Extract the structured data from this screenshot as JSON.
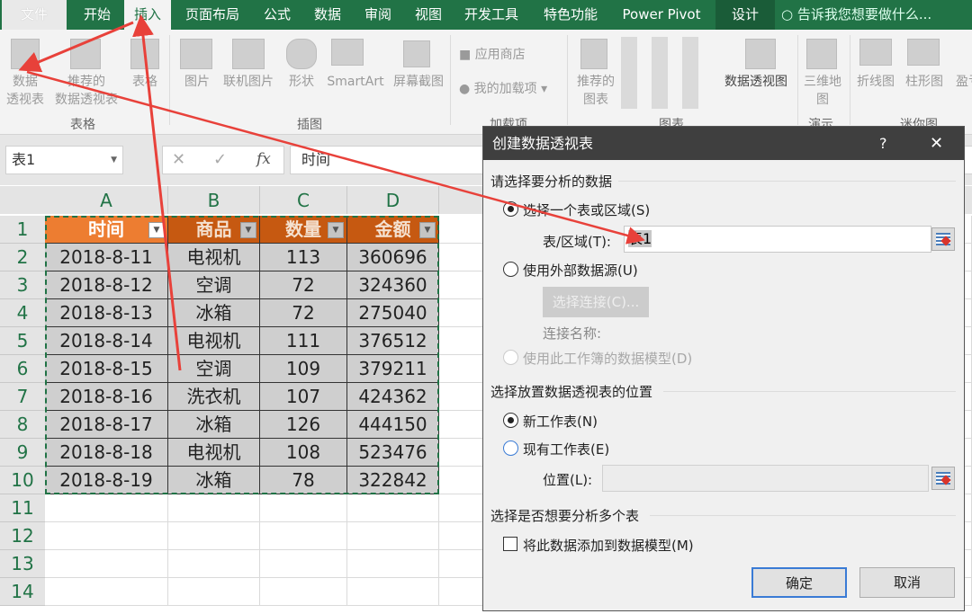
{
  "tabs": [
    "文件",
    "开始",
    "插入",
    "页面布局",
    "公式",
    "数据",
    "审阅",
    "视图",
    "开发工具",
    "特色功能",
    "Power Pivot",
    "设计"
  ],
  "tell_me": "告诉我您想要做什么...",
  "ribbon": {
    "pivot_table": [
      "数据",
      "透视表"
    ],
    "recommended_pivot": [
      "推荐的",
      "数据透视表"
    ],
    "table": "表格",
    "pictures": "图片",
    "online_pictures": "联机图片",
    "shapes": "形状",
    "smartart": "SmartArt",
    "screenshot": "屏幕截图",
    "store": "应用商店",
    "my_addins": "我的加载项",
    "recommended_charts": [
      "推荐的",
      "图表"
    ],
    "pivot_chart": "数据透视图",
    "map3d": [
      "三维地",
      "图"
    ],
    "line": "折线图",
    "column": "柱形图",
    "winloss": "盈亏",
    "groups": {
      "tables": "表格",
      "illustrations": "插图",
      "addins": "加载项",
      "charts": "图表",
      "tours": "演示",
      "sparklines": "迷你图"
    }
  },
  "formula_bar": {
    "name_box": "表1",
    "fx": "fx",
    "cancel": "✕",
    "enter": "✓",
    "content": "时间"
  },
  "sheet": {
    "columns": [
      "A",
      "B",
      "C",
      "D"
    ],
    "rows": [
      "1",
      "2",
      "3",
      "4",
      "5",
      "6",
      "7",
      "8",
      "9",
      "10",
      "11",
      "12",
      "13",
      "14"
    ],
    "headers": [
      "时间",
      "商品",
      "数量",
      "金额"
    ],
    "data": [
      [
        "2018-8-11",
        "电视机",
        "113",
        "360696"
      ],
      [
        "2018-8-12",
        "空调",
        "72",
        "324360"
      ],
      [
        "2018-8-13",
        "冰箱",
        "72",
        "275040"
      ],
      [
        "2018-8-14",
        "电视机",
        "111",
        "376512"
      ],
      [
        "2018-8-15",
        "空调",
        "109",
        "379211"
      ],
      [
        "2018-8-16",
        "洗衣机",
        "107",
        "424362"
      ],
      [
        "2018-8-17",
        "冰箱",
        "126",
        "444150"
      ],
      [
        "2018-8-18",
        "电视机",
        "108",
        "523476"
      ],
      [
        "2018-8-19",
        "冰箱",
        "78",
        "322842"
      ]
    ]
  },
  "dialog": {
    "title": "创建数据透视表",
    "help": "?",
    "close": "✕",
    "section1": "请选择要分析的数据",
    "opt_table": "选择一个表或区域(S)",
    "range_label": "表/区域(T):",
    "range_value": "表1",
    "opt_external": "使用外部数据源(U)",
    "choose_conn": "选择连接(C)...",
    "conn_name": "连接名称:",
    "opt_model": "使用此工作簿的数据模型(D)",
    "section2": "选择放置数据透视表的位置",
    "opt_new": "新工作表(N)",
    "opt_existing": "现有工作表(E)",
    "location_label": "位置(L):",
    "location_value": "",
    "section3": "选择是否想要分析多个表",
    "add_model": "将此数据添加到数据模型(M)",
    "ok": "确定",
    "cancel": "取消"
  },
  "colors": {
    "accent": "#217346",
    "header_orange": "#ed7d31",
    "header_dark": "#c65911",
    "arrow": "#e8413a"
  }
}
